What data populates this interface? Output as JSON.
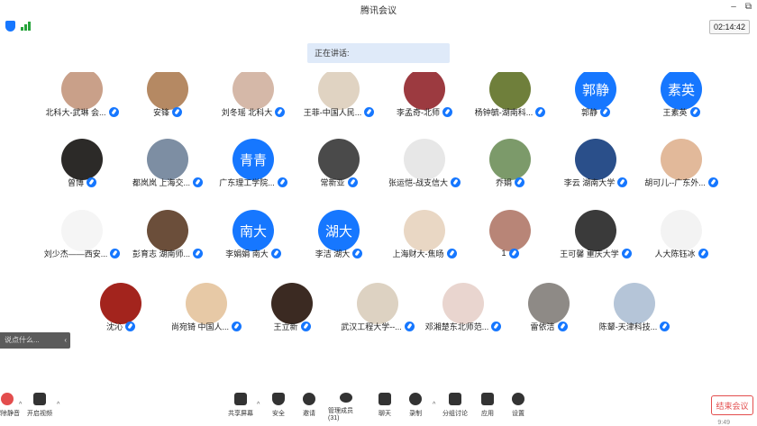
{
  "title": "腾讯会议",
  "window_buttons": [
    "–",
    "⧉"
  ],
  "clock": "02:14:42",
  "speaking_label": "正在讲话:",
  "participants": [
    {
      "name": "北科大-武琳  会...",
      "avatar_text": "",
      "bg": "#c9a089"
    },
    {
      "name": "安锋",
      "avatar_text": "",
      "bg": "#b58963"
    },
    {
      "name": "刘冬瑶 北科大",
      "avatar_text": "",
      "bg": "#d5b8a8"
    },
    {
      "name": "王菲-中国人民...",
      "avatar_text": "",
      "bg": "#e0d3c2"
    },
    {
      "name": "李孟奇-北师",
      "avatar_text": "",
      "bg": "#9c3a40"
    },
    {
      "name": "杨钟毓-湖南科...",
      "avatar_text": "",
      "bg": "#6f7f3b"
    },
    {
      "name": "郭静",
      "avatar_text": "郭静",
      "bg": "#1677ff"
    },
    {
      "name": "王素英",
      "avatar_text": "素英",
      "bg": "#1677ff"
    },
    {
      "name": "曾博",
      "avatar_text": "",
      "bg": "#2c2a28"
    },
    {
      "name": "都岚岚 上海交...",
      "avatar_text": "",
      "bg": "#7d8ea3"
    },
    {
      "name": "广东理工学院...",
      "avatar_text": "青青",
      "bg": "#1677ff"
    },
    {
      "name": "常新亚",
      "avatar_text": "",
      "bg": "#4a4a4a"
    },
    {
      "name": "张运恺-战支信大",
      "avatar_text": "",
      "bg": "#e7e7e7"
    },
    {
      "name": "乔娟",
      "avatar_text": "",
      "bg": "#7c9a6a"
    },
    {
      "name": "李云  湖南大学",
      "avatar_text": "",
      "bg": "#2a4f8a"
    },
    {
      "name": "胡可儿--广东外...",
      "avatar_text": "",
      "bg": "#e2b99a"
    },
    {
      "name": "刘少杰——西安...",
      "avatar_text": "",
      "bg": "#f5f5f5"
    },
    {
      "name": "彭育志 湖南师...",
      "avatar_text": "",
      "bg": "#6b4e3a"
    },
    {
      "name": "李娟娟 南大",
      "avatar_text": "南大",
      "bg": "#1677ff"
    },
    {
      "name": "李洁 湖大",
      "avatar_text": "湖大",
      "bg": "#1677ff"
    },
    {
      "name": "上海财大-焦旸",
      "avatar_text": "",
      "bg": "#e9d7c4"
    },
    {
      "name": "1",
      "avatar_text": "",
      "bg": "#b88577"
    },
    {
      "name": "王可馨 重庆大学",
      "avatar_text": "",
      "bg": "#3a3a3a"
    },
    {
      "name": "人大陈钰冰",
      "avatar_text": "",
      "bg": "#f3f3f3"
    },
    {
      "name": "沈沁",
      "avatar_text": "",
      "bg": "#a3241d"
    },
    {
      "name": "尚宛锜 中国人...",
      "avatar_text": "",
      "bg": "#e7c9a6"
    },
    {
      "name": "王立新",
      "avatar_text": "",
      "bg": "#3b2a22"
    },
    {
      "name": "武汉工程大学--...",
      "avatar_text": "",
      "bg": "#ddd2c2"
    },
    {
      "name": "邓湘楚东北师范...",
      "avatar_text": "",
      "bg": "#e9d5cf"
    },
    {
      "name": "雷依洁",
      "avatar_text": "",
      "bg": "#8e8a86"
    },
    {
      "name": "陈颦-天津科技...",
      "avatar_text": "",
      "bg": "#b5c5d8"
    }
  ],
  "chat_placeholder": "说点什么...",
  "chat_arrow": "‹",
  "toolbar": {
    "mute": "解除静音",
    "video": "开启视频",
    "share": "共享屏幕",
    "security": "安全",
    "invite": "邀请",
    "members": "管理成员(31)",
    "chat": "聊天",
    "record": "录制",
    "breakout": "分组讨论",
    "apps": "应用",
    "settings": "设置",
    "end": "结束会议"
  },
  "corner_time": "9:49"
}
